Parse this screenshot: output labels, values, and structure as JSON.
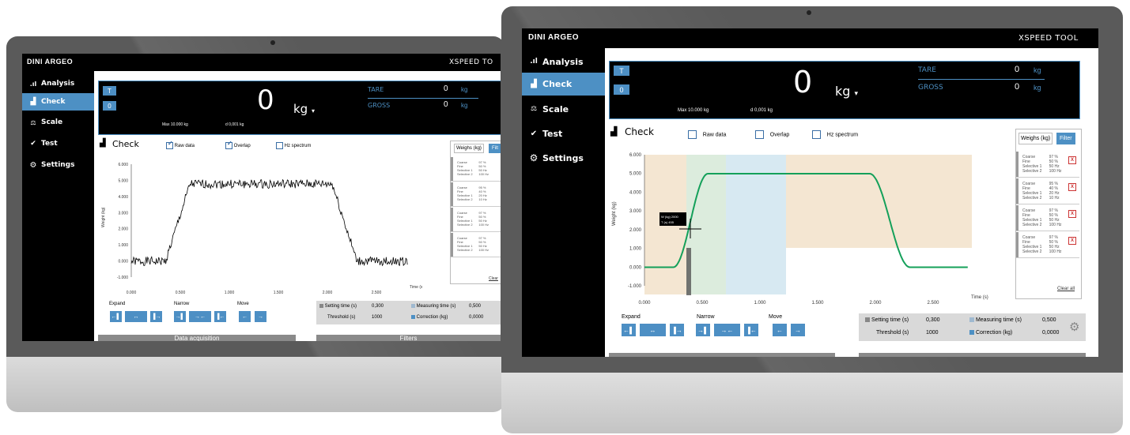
{
  "app": {
    "brand": "DINI ARGEO",
    "title": "XSPEED TOOL",
    "title_truncated": "XSPEED TO"
  },
  "sidebar": {
    "items": [
      {
        "label": "Analysis",
        "icon": "bar-chart-icon"
      },
      {
        "label": "Check",
        "icon": "scale-check-icon"
      },
      {
        "label": "Scale",
        "icon": "scale-icon"
      },
      {
        "label": "Test",
        "icon": "check-icon"
      },
      {
        "label": "Settings",
        "icon": "gear-icon"
      }
    ],
    "active": "Check"
  },
  "weight": {
    "value": "0",
    "unit": "kg",
    "tare_label": "TARE",
    "tare_value": "0",
    "tare_unit": "kg",
    "gross_label": "GROSS",
    "gross_value": "0",
    "gross_unit": "kg",
    "max": "Max  10.000 kg",
    "d": "d  0,001 kg",
    "btn_tare": "T",
    "btn_zero": "0"
  },
  "check": {
    "title": "Check",
    "raw_data": "Raw data",
    "overlap": "Overlap",
    "hz_spectrum": "Hz spectrum",
    "raw_data_checked_left": true,
    "overlap_checked_left": true,
    "ylabel": "Weight (kg)",
    "ylabel_right": "Weight (kg)",
    "xlabel": "Time (s)",
    "y_ticks": [
      "6.000",
      "5.000",
      "4.000",
      "3.000",
      "2.000",
      "1.000",
      "0.000",
      "-1.000"
    ],
    "x_ticks_left": [
      "0.000",
      "0.500",
      "1.000",
      "1.500",
      "2.000",
      "2.500"
    ],
    "x_ticks_right": [
      "0.000",
      "0.500",
      "1.000",
      "1.500",
      "2.000",
      "2.500"
    ],
    "cursor_w": "W (kg)   2000",
    "cursor_t": "T (s)         455"
  },
  "tools": {
    "expand": "Expand",
    "narrow": "Narrow",
    "move": "Move",
    "setting_time_label": "Setting time (s)",
    "setting_time": "0,300",
    "measuring_time_label": "Measuring time (s)",
    "measuring_time": "0,500",
    "threshold_label": "Threshold (s)",
    "threshold": "1000",
    "correction_label": "Correction (kg)",
    "correction": "0,0000",
    "data_acq": "Data acquisition",
    "filters": "Filters"
  },
  "filters_panel": {
    "tab_weighs": "Weighs (kg)",
    "tab_filter": "Filter",
    "tab_filter_trunc": "Filt",
    "clear_all": "Clear all",
    "clear_trunc": "Clear",
    "entries": [
      {
        "coarse": "97 %",
        "fine": "50 %",
        "sel1": "50 Hz",
        "sel2": "100 Hz"
      },
      {
        "coarse": "95 %",
        "fine": "40 %",
        "sel1": "20 Hz",
        "sel2": "10 Hz"
      },
      {
        "coarse": "97 %",
        "fine": "50 %",
        "sel1": "50 Hz",
        "sel2": "100 Hz"
      },
      {
        "coarse": "97 %",
        "fine": "50 %",
        "sel1": "50 Hz",
        "sel2": "100 Hz"
      }
    ],
    "lbl_coarse": "Coarse",
    "lbl_fine": "Fine",
    "lbl_sel1": "Selective 1",
    "lbl_sel2": "Selective 2"
  },
  "colors": {
    "accent": "#4d90c4",
    "curve_right": "#14a05a",
    "bezel": "#9a9a9a",
    "screen_black": "#000000"
  }
}
